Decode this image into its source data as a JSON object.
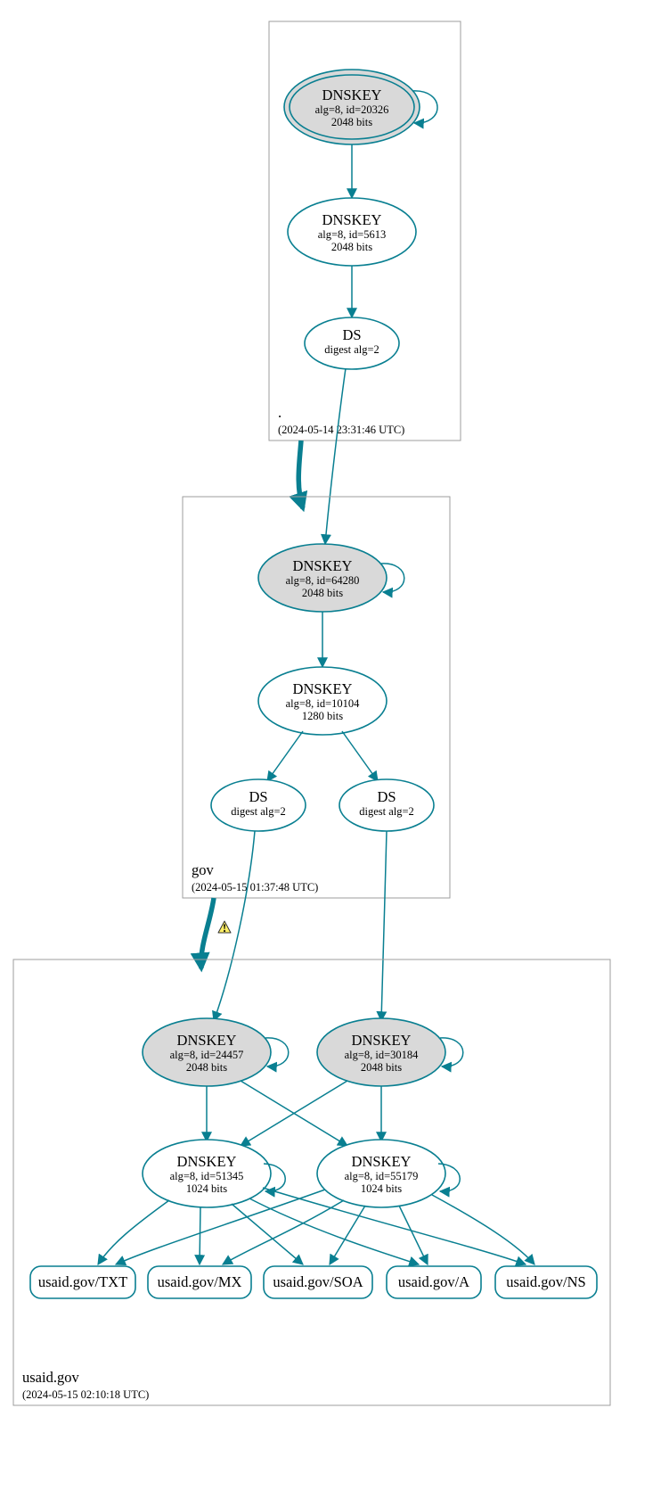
{
  "colors": {
    "stroke": "#097f91",
    "fill_grey": "#d9d9d9",
    "warn": "#ffef66"
  },
  "zones": {
    "root": {
      "label": ".",
      "timestamp": "(2024-05-14 23:31:46 UTC)"
    },
    "gov": {
      "label": "gov",
      "timestamp": "(2024-05-15 01:37:48 UTC)"
    },
    "usaid": {
      "label": "usaid.gov",
      "timestamp": "(2024-05-15 02:10:18 UTC)"
    }
  },
  "nodes": {
    "root_ksk": {
      "title": "DNSKEY",
      "line2": "alg=8, id=20326",
      "line3": "2048 bits"
    },
    "root_zsk": {
      "title": "DNSKEY",
      "line2": "alg=8, id=5613",
      "line3": "2048 bits"
    },
    "root_ds": {
      "title": "DS",
      "line2": "digest alg=2",
      "line3": ""
    },
    "gov_ksk": {
      "title": "DNSKEY",
      "line2": "alg=8, id=64280",
      "line3": "2048 bits"
    },
    "gov_zsk": {
      "title": "DNSKEY",
      "line2": "alg=8, id=10104",
      "line3": "1280 bits"
    },
    "gov_ds1": {
      "title": "DS",
      "line2": "digest alg=2",
      "line3": ""
    },
    "gov_ds2": {
      "title": "DS",
      "line2": "digest alg=2",
      "line3": ""
    },
    "usaid_ksk1": {
      "title": "DNSKEY",
      "line2": "alg=8, id=24457",
      "line3": "2048 bits"
    },
    "usaid_ksk2": {
      "title": "DNSKEY",
      "line2": "alg=8, id=30184",
      "line3": "2048 bits"
    },
    "usaid_zsk1": {
      "title": "DNSKEY",
      "line2": "alg=8, id=51345",
      "line3": "1024 bits"
    },
    "usaid_zsk2": {
      "title": "DNSKEY",
      "line2": "alg=8, id=55179",
      "line3": "1024 bits"
    }
  },
  "rr": {
    "txt": "usaid.gov/TXT",
    "mx": "usaid.gov/MX",
    "soa": "usaid.gov/SOA",
    "a": "usaid.gov/A",
    "ns": "usaid.gov/NS"
  },
  "chart_data": {
    "type": "graph-dnssec-delegation",
    "zones": [
      {
        "name": ".",
        "timestamp": "2024-05-14 23:31:46 UTC",
        "keys": [
          {
            "id": 20326,
            "alg": 8,
            "bits": 2048,
            "role": "KSK",
            "trust_anchor": true
          },
          {
            "id": 5613,
            "alg": 8,
            "bits": 2048,
            "role": "ZSK"
          }
        ],
        "ds": [
          {
            "digest_alg": 2,
            "delegates_to": "gov"
          }
        ]
      },
      {
        "name": "gov",
        "timestamp": "2024-05-15 01:37:48 UTC",
        "keys": [
          {
            "id": 64280,
            "alg": 8,
            "bits": 2048,
            "role": "KSK"
          },
          {
            "id": 10104,
            "alg": 8,
            "bits": 1280,
            "role": "ZSK"
          }
        ],
        "ds": [
          {
            "digest_alg": 2,
            "delegates_to": "usaid.gov"
          },
          {
            "digest_alg": 2,
            "delegates_to": "usaid.gov"
          }
        ],
        "delegation_status": "secure"
      },
      {
        "name": "usaid.gov",
        "timestamp": "2024-05-15 02:10:18 UTC",
        "keys": [
          {
            "id": 24457,
            "alg": 8,
            "bits": 2048,
            "role": "KSK"
          },
          {
            "id": 30184,
            "alg": 8,
            "bits": 2048,
            "role": "KSK"
          },
          {
            "id": 51345,
            "alg": 8,
            "bits": 1024,
            "role": "ZSK"
          },
          {
            "id": 55179,
            "alg": 8,
            "bits": 1024,
            "role": "ZSK"
          }
        ],
        "rrsets_signed": [
          "TXT",
          "MX",
          "SOA",
          "A",
          "NS"
        ],
        "delegation_status": "warning"
      }
    ],
    "edges": [
      {
        "from": "./DNSKEY/20326",
        "to": "./DNSKEY/20326",
        "kind": "self-sign"
      },
      {
        "from": "./DNSKEY/20326",
        "to": "./DNSKEY/5613",
        "kind": "signs"
      },
      {
        "from": "./DNSKEY/5613",
        "to": "./DS",
        "kind": "signs"
      },
      {
        "from": "./DS",
        "to": "gov/DNSKEY/64280",
        "kind": "delegation"
      },
      {
        "from": ".",
        "to": "gov",
        "kind": "zone-delegation",
        "status": "secure"
      },
      {
        "from": "gov/DNSKEY/64280",
        "to": "gov/DNSKEY/64280",
        "kind": "self-sign"
      },
      {
        "from": "gov/DNSKEY/64280",
        "to": "gov/DNSKEY/10104",
        "kind": "signs"
      },
      {
        "from": "gov/DNSKEY/10104",
        "to": "gov/DS/1",
        "kind": "signs"
      },
      {
        "from": "gov/DNSKEY/10104",
        "to": "gov/DS/2",
        "kind": "signs"
      },
      {
        "from": "gov/DS/1",
        "to": "usaid.gov/DNSKEY/24457",
        "kind": "delegation"
      },
      {
        "from": "gov/DS/2",
        "to": "usaid.gov/DNSKEY/30184",
        "kind": "delegation"
      },
      {
        "from": "gov",
        "to": "usaid.gov",
        "kind": "zone-delegation",
        "status": "warning"
      },
      {
        "from": "usaid.gov/DNSKEY/24457",
        "to": "usaid.gov/DNSKEY/24457",
        "kind": "self-sign"
      },
      {
        "from": "usaid.gov/DNSKEY/30184",
        "to": "usaid.gov/DNSKEY/30184",
        "kind": "self-sign"
      },
      {
        "from": "usaid.gov/DNSKEY/24457",
        "to": "usaid.gov/DNSKEY/51345",
        "kind": "signs"
      },
      {
        "from": "usaid.gov/DNSKEY/24457",
        "to": "usaid.gov/DNSKEY/55179",
        "kind": "signs"
      },
      {
        "from": "usaid.gov/DNSKEY/30184",
        "to": "usaid.gov/DNSKEY/51345",
        "kind": "signs"
      },
      {
        "from": "usaid.gov/DNSKEY/30184",
        "to": "usaid.gov/DNSKEY/55179",
        "kind": "signs"
      },
      {
        "from": "usaid.gov/DNSKEY/51345",
        "to": "usaid.gov/DNSKEY/51345",
        "kind": "self-sign"
      },
      {
        "from": "usaid.gov/DNSKEY/55179",
        "to": "usaid.gov/DNSKEY/55179",
        "kind": "self-sign"
      },
      {
        "from": "usaid.gov/DNSKEY/51345",
        "to": "usaid.gov/TXT",
        "kind": "signs"
      },
      {
        "from": "usaid.gov/DNSKEY/51345",
        "to": "usaid.gov/MX",
        "kind": "signs"
      },
      {
        "from": "usaid.gov/DNSKEY/51345",
        "to": "usaid.gov/SOA",
        "kind": "signs"
      },
      {
        "from": "usaid.gov/DNSKEY/51345",
        "to": "usaid.gov/A",
        "kind": "signs"
      },
      {
        "from": "usaid.gov/DNSKEY/51345",
        "to": "usaid.gov/NS",
        "kind": "signs"
      },
      {
        "from": "usaid.gov/DNSKEY/55179",
        "to": "usaid.gov/TXT",
        "kind": "signs"
      },
      {
        "from": "usaid.gov/DNSKEY/55179",
        "to": "usaid.gov/MX",
        "kind": "signs"
      },
      {
        "from": "usaid.gov/DNSKEY/55179",
        "to": "usaid.gov/SOA",
        "kind": "signs"
      },
      {
        "from": "usaid.gov/DNSKEY/55179",
        "to": "usaid.gov/A",
        "kind": "signs"
      },
      {
        "from": "usaid.gov/DNSKEY/55179",
        "to": "usaid.gov/NS",
        "kind": "signs"
      }
    ]
  }
}
